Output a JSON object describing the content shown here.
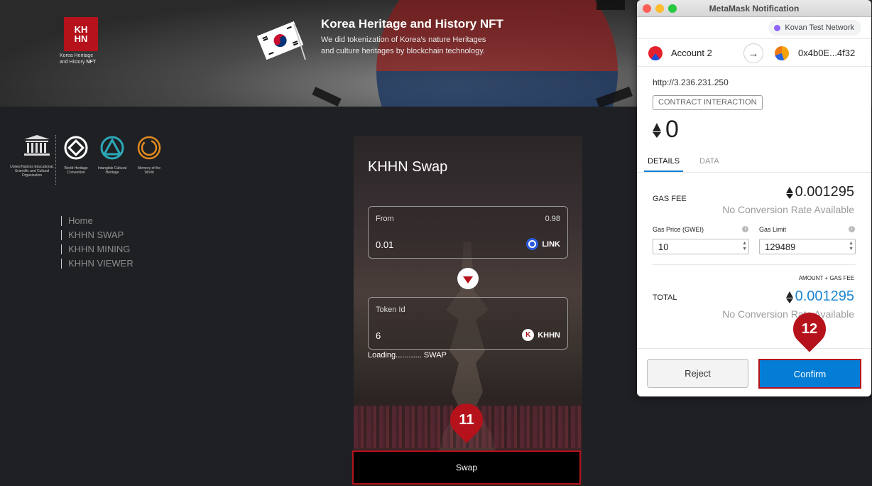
{
  "banner": {
    "logo_letters": "KHHN",
    "logo_caption_line1": "Korea Heritage",
    "logo_caption_line2": "and History",
    "logo_caption_nft": "NFT",
    "title": "Korea Heritage and History NFT",
    "description": "We did tokenization of Korea's nature Heritages and culture heritages by blockchain technology."
  },
  "org_logos": [
    {
      "icon": "unesco-icon",
      "caption": "United Nations Educational, Scientific and Cultural Organization"
    },
    {
      "icon": "world-heritage-icon",
      "caption": "World Heritage Convention"
    },
    {
      "icon": "intangible-heritage-icon",
      "caption": "Intangible Cultural Heritage"
    },
    {
      "icon": "memory-of-world-icon",
      "caption": "Memory of the World"
    }
  ],
  "nav": {
    "items": [
      "Home",
      "KHHN SWAP",
      "KHHN MINING",
      "KHHN VIEWER"
    ]
  },
  "swap": {
    "title": "KHHN Swap",
    "from": {
      "label": "From",
      "balance": "0.98",
      "value": "0.01",
      "token": "LINK",
      "token_icon": "chainlink-icon"
    },
    "to": {
      "label": "Token Id",
      "value": "6",
      "token": "KHHN",
      "token_icon": "khhn-token-icon"
    },
    "loading_text": "Loading............ SWAP",
    "button_label": "Swap"
  },
  "markers": {
    "swap_step": "11",
    "confirm_step": "12"
  },
  "metamask": {
    "window_title": "MetaMask Notification",
    "network": "Kovan Test Network",
    "from_account": "Account 2",
    "to_account": "0x4b0E...4f32",
    "origin": "http://3.236.231.250",
    "badge": "CONTRACT INTERACTION",
    "amount": "0",
    "tabs": [
      "DETAILS",
      "DATA"
    ],
    "gas_fee_label": "GAS FEE",
    "gas_fee_value": "0.001295",
    "no_conversion": "No Conversion Rate Available",
    "gas_price_label": "Gas Price (GWEI)",
    "gas_price_value": "10",
    "gas_limit_label": "Gas Limit",
    "gas_limit_value": "129489",
    "amount_gas_label": "AMOUNT + GAS FEE",
    "total_label": "TOTAL",
    "total_value": "0.001295",
    "reject_label": "Reject",
    "confirm_label": "Confirm"
  },
  "colors": {
    "brand_red": "#b5121b",
    "metamask_blue": "#037dd6",
    "total_blue": "#1c86d1",
    "network_dot": "#9064ff"
  }
}
